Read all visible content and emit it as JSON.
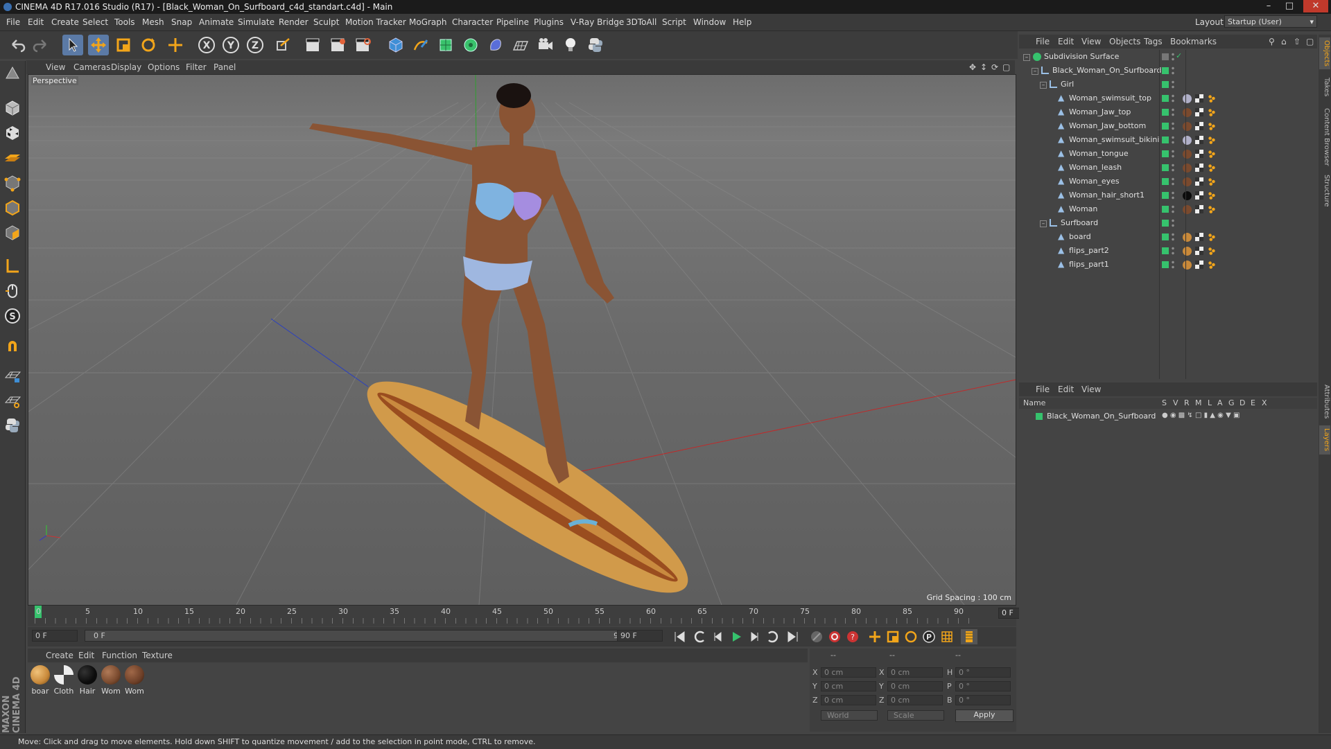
{
  "window": {
    "title": "CINEMA 4D R17.016 Studio (R17) - [Black_Woman_On_Surfboard_c4d_standart.c4d] - Main"
  },
  "menubar": {
    "items": [
      "File",
      "Edit",
      "Create",
      "Select",
      "Tools",
      "Mesh",
      "Snap",
      "Animate",
      "Simulate",
      "Render",
      "Sculpt",
      "Motion Tracker",
      "MoGraph",
      "Character",
      "Pipeline",
      "Plugins",
      "V-Ray Bridge",
      "3DToAll",
      "Script",
      "Window",
      "Help"
    ],
    "layout_label": "Layout:",
    "layout_value": "Startup (User)"
  },
  "viewport": {
    "menu": [
      "View",
      "Cameras",
      "Display",
      "Options",
      "Filter",
      "Panel"
    ],
    "label": "Perspective",
    "grid_spacing": "Grid Spacing : 100 cm"
  },
  "timeline": {
    "ticks": [
      "0",
      "5",
      "10",
      "15",
      "20",
      "25",
      "30",
      "35",
      "40",
      "45",
      "50",
      "55",
      "60",
      "65",
      "70",
      "75",
      "80",
      "85",
      "90"
    ],
    "current_frame": "0 F",
    "start_field": "0 F",
    "range_start": "0 F",
    "range_end": "90 F",
    "end_field": "90 F"
  },
  "materials": {
    "menu": [
      "Create",
      "Edit",
      "Function",
      "Texture"
    ],
    "items": [
      {
        "label": "boar",
        "color": "#c8893a"
      },
      {
        "label": "Cloth",
        "color": "#9a9a9a"
      },
      {
        "label": "Hair",
        "color": "#0c0c0c"
      },
      {
        "label": "Wom",
        "color": "#7a4a2e"
      },
      {
        "label": "Wom",
        "color": "#6e4028"
      }
    ]
  },
  "coordinates": {
    "header": [
      "--",
      "--",
      "--"
    ],
    "rows": [
      {
        "a": "X",
        "av": "0 cm",
        "b": "X",
        "bv": "0 cm",
        "c": "H",
        "cv": "0 °"
      },
      {
        "a": "Y",
        "av": "0 cm",
        "b": "Y",
        "bv": "0 cm",
        "c": "P",
        "cv": "0 °"
      },
      {
        "a": "Z",
        "av": "0 cm",
        "b": "Z",
        "bv": "0 cm",
        "c": "B",
        "cv": "0 °"
      }
    ],
    "mode1": "World",
    "mode2": "Scale",
    "apply": "Apply"
  },
  "status": {
    "text": "Move: Click and drag to move elements. Hold down SHIFT to quantize movement / add to the selection in point mode, CTRL to remove."
  },
  "object_manager": {
    "menu": [
      "File",
      "Edit",
      "View",
      "Objects",
      "Tags",
      "Bookmarks"
    ],
    "rows": [
      {
        "name": "Subdivision Surface",
        "indent": 0,
        "type": "subdiv"
      },
      {
        "name": "Black_Woman_On_Surfboard",
        "indent": 1,
        "type": "null"
      },
      {
        "name": "Girl",
        "indent": 2,
        "type": "null"
      },
      {
        "name": "Woman_swimsuit_top",
        "indent": 3,
        "type": "mesh"
      },
      {
        "name": "Woman_Jaw_top",
        "indent": 3,
        "type": "mesh"
      },
      {
        "name": "Woman_Jaw_bottom",
        "indent": 3,
        "type": "mesh"
      },
      {
        "name": "Woman_swimsuit_bikini",
        "indent": 3,
        "type": "mesh"
      },
      {
        "name": "Woman_tongue",
        "indent": 3,
        "type": "mesh"
      },
      {
        "name": "Woman_leash",
        "indent": 3,
        "type": "mesh"
      },
      {
        "name": "Woman_eyes",
        "indent": 3,
        "type": "mesh"
      },
      {
        "name": "Woman_hair_short1",
        "indent": 3,
        "type": "mesh"
      },
      {
        "name": "Woman",
        "indent": 3,
        "type": "mesh"
      },
      {
        "name": "Surfboard",
        "indent": 2,
        "type": "null"
      },
      {
        "name": "board",
        "indent": 3,
        "type": "mesh"
      },
      {
        "name": "flips_part2",
        "indent": 3,
        "type": "mesh"
      },
      {
        "name": "flips_part1",
        "indent": 3,
        "type": "mesh"
      }
    ]
  },
  "layer_manager": {
    "menu": [
      "File",
      "Edit",
      "View"
    ],
    "columns": [
      "Name",
      "S",
      "V",
      "R",
      "M",
      "L",
      "A",
      "G",
      "D",
      "E",
      "X"
    ],
    "layers": [
      {
        "name": "Black_Woman_On_Surfboard",
        "color": "#36c26d"
      }
    ]
  },
  "right_tabs": [
    "Objects",
    "Takes",
    "Content Browser",
    "Structure",
    "Attributes",
    "Layers"
  ],
  "icons": {
    "undo": "undo-icon",
    "redo": "redo-icon",
    "select": "arrow-icon",
    "move": "move-icon",
    "scale": "scale-icon",
    "rotate": "rotate-icon"
  }
}
